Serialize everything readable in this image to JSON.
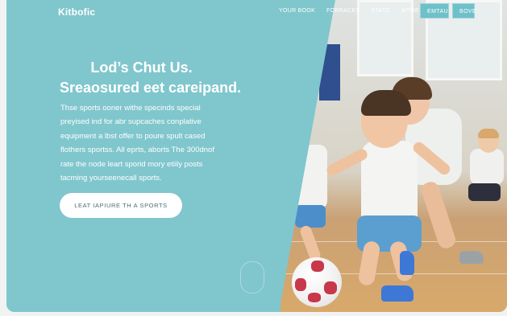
{
  "header": {
    "logo": "Kitbofic",
    "nav": [
      "YOUR BOOK",
      "FORRACKS",
      "STATC",
      "APPIE"
    ],
    "button_primary": "EMTAU",
    "button_secondary": "BOVE"
  },
  "hero": {
    "title": "Lod’s Chut Us.",
    "subtitle": "Sreaosured eet careipand.",
    "body_lines": [
      "Thse sports ooner withe specinds special",
      "preyised ind for abr supcaches conplative",
      "equipment a lbst offer to poure spult cased",
      "flothers sportss. All eprts, aborts The 300dnof",
      "rate the node leart sporid mory etiily posts",
      "tacming yourseenecall sports."
    ],
    "cta_label": "LEAT IAPIURE TH A SPORTS"
  },
  "colors": {
    "panel": "#80c6cd",
    "button": "#6ec0c9",
    "ball_patch": "#c8374a",
    "shorts": "#5b9fd0"
  }
}
